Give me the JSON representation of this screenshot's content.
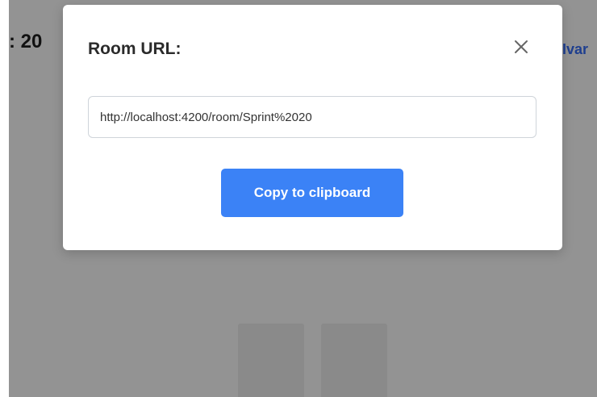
{
  "background": {
    "room_title_fragment": ": 20",
    "user_name_fragment": "Ivar"
  },
  "modal": {
    "title": "Room URL:",
    "close_icon": "close-icon",
    "url_value": "http://localhost:4200/room/Sprint%2020",
    "copy_label": "Copy to clipboard"
  },
  "colors": {
    "overlay": "#939393",
    "accent": "#3b82f6",
    "user_link": "#1f3f8f"
  }
}
